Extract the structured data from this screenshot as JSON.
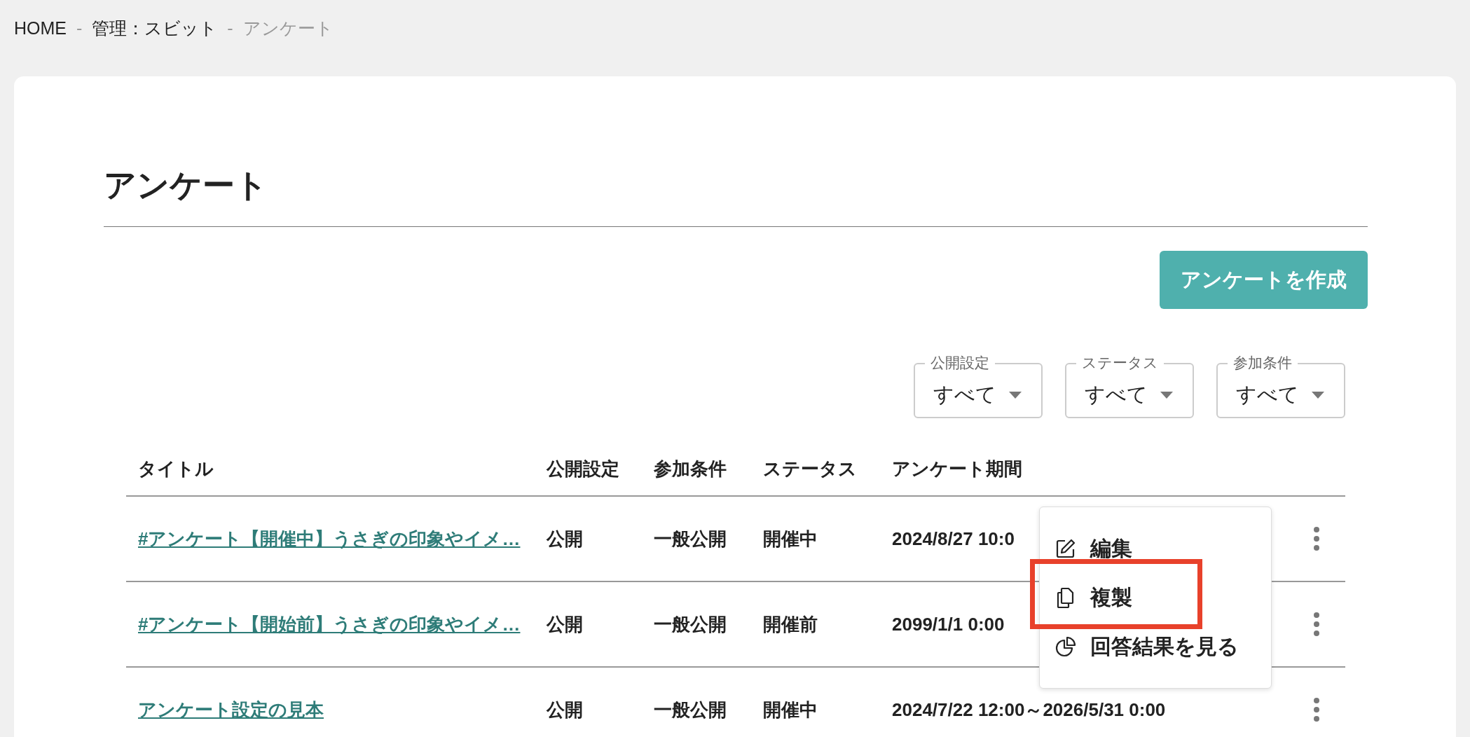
{
  "breadcrumb": [
    {
      "label": "HOME",
      "current": false,
      "separator": "-"
    },
    {
      "label": "管理：スビット",
      "current": false,
      "separator": "-"
    },
    {
      "label": "アンケート",
      "current": true
    }
  ],
  "page_title": "アンケート",
  "create_button": "アンケートを作成",
  "filters": [
    {
      "label": "公開設定",
      "value": "すべて"
    },
    {
      "label": "ステータス",
      "value": "すべて"
    },
    {
      "label": "参加条件",
      "value": "すべて"
    }
  ],
  "table": {
    "columns": [
      "タイトル",
      "公開設定",
      "参加条件",
      "ステータス",
      "アンケート期間"
    ],
    "rows": [
      {
        "title": "#アンケート【開催中】うさぎの印象やイメ…",
        "visibility": "公開",
        "condition": "一般公開",
        "status": "開催中",
        "period": "2024/8/27 10:0"
      },
      {
        "title": "#アンケート【開始前】うさぎの印象やイメ…",
        "visibility": "公開",
        "condition": "一般公開",
        "status": "開催前",
        "period": "2099/1/1 0:00"
      },
      {
        "title": "アンケート設定の見本",
        "visibility": "公開",
        "condition": "一般公開",
        "status": "開催中",
        "period": "2024/7/22 12:00～2026/5/31 0:00"
      }
    ]
  },
  "context_menu": {
    "items": [
      {
        "kind": "edit",
        "label": "編集",
        "highlighted": false
      },
      {
        "kind": "copy",
        "label": "複製",
        "highlighted": true
      },
      {
        "kind": "results",
        "label": "回答結果を見る",
        "highlighted": false
      }
    ]
  }
}
